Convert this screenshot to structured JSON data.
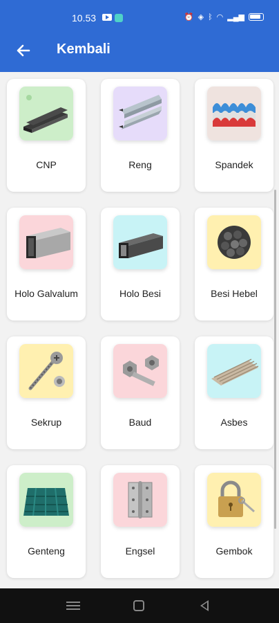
{
  "status_bar": {
    "time": "10.53",
    "right_icons": [
      "alarm-icon",
      "vibrate-icon",
      "bluetooth-icon",
      "wifi-icon",
      "signal-icon",
      "battery-icon"
    ]
  },
  "app_bar": {
    "title": "Kembali",
    "back_icon": "arrow-left-icon",
    "color": "#2f6bd4"
  },
  "categories": [
    {
      "label": "CNP",
      "bg": "#cdeec9"
    },
    {
      "label": "Reng",
      "bg": "#e6dcfa"
    },
    {
      "label": "Spandek",
      "bg": "#efe3df"
    },
    {
      "label": "Holo Galvalum",
      "bg": "#fbd6da"
    },
    {
      "label": "Holo Besi",
      "bg": "#c8f3f6"
    },
    {
      "label": "Besi Hebel",
      "bg": "#fff0b0"
    },
    {
      "label": "Sekrup",
      "bg": "#fff0b0"
    },
    {
      "label": "Baud",
      "bg": "#fbd6da"
    },
    {
      "label": "Asbes",
      "bg": "#c8f3f6"
    },
    {
      "label": "Genteng",
      "bg": "#cdeec9"
    },
    {
      "label": "Engsel",
      "bg": "#fbd6da"
    },
    {
      "label": "Gembok",
      "bg": "#fff0b0"
    }
  ],
  "nav_bar": {
    "buttons": [
      "recents-icon",
      "home-icon",
      "back-icon"
    ]
  }
}
